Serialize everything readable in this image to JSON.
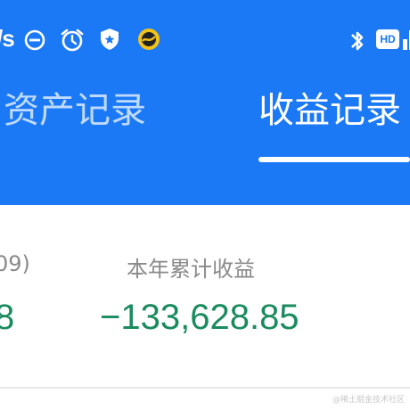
{
  "status_bar": {
    "left_text": "/s",
    "icons": [
      "do-not-disturb-icon",
      "alarm-icon",
      "shield-star-icon",
      "app-badge-icon",
      "bluetooth-icon",
      "hd-badge-icon",
      "network-icon"
    ],
    "hd_label": "HD"
  },
  "tabs": [
    {
      "label": "资产记录",
      "active": false
    },
    {
      "label": "收益记录",
      "active": true
    }
  ],
  "summary": {
    "left_label": "09)",
    "left_value": "8",
    "year_label": "本年累计收益",
    "year_value": "−133,628.85"
  },
  "watermark": "@稀土掘金技术社区",
  "colors": {
    "header_bg": "#1b79f6",
    "negative_value": "#1a8b5f",
    "label_gray": "#8a8a8a"
  }
}
